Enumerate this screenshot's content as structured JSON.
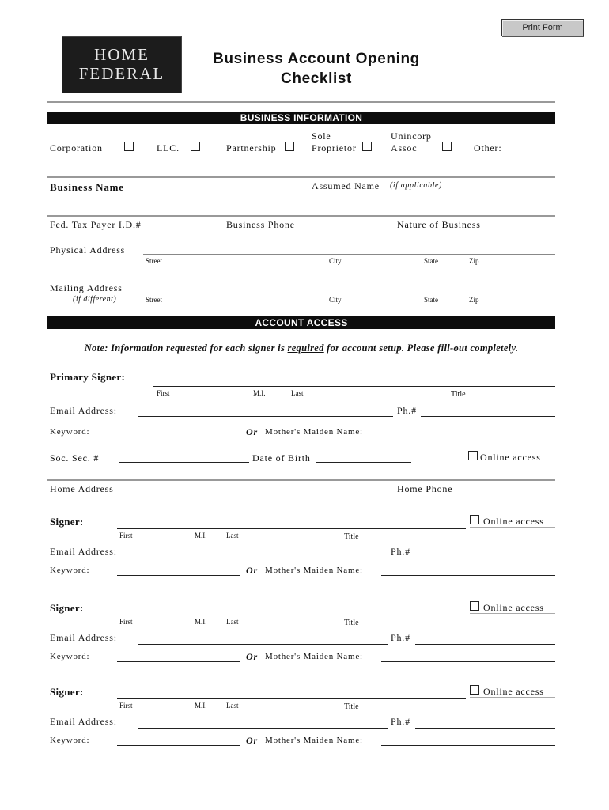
{
  "toolbar": {
    "print_label": "Print Form"
  },
  "logo": {
    "line1": "HOME",
    "line2": "FEDERAL"
  },
  "header": {
    "title_line1": "Business Account Opening",
    "title_line2": "Checklist"
  },
  "business_info": {
    "section_title": "BUSINESS INFORMATION",
    "entity_types": {
      "corporation": "Corporation",
      "llc": "LLC.",
      "partnership": "Partnership",
      "sole_proprietor_1": "Sole",
      "sole_proprietor_2": "Proprietor",
      "unincorp_1": "Unincorp",
      "unincorp_2": "Assoc",
      "other": "Other:"
    },
    "business_name": "Business Name",
    "assumed_name": "Assumed Name",
    "assumed_name_note": "(if applicable)",
    "tax_id": "Fed. Tax Payer I.D.#",
    "business_phone": "Business Phone",
    "nature_of_business": "Nature of Business",
    "physical_address": "Physical Address",
    "mailing_address": "Mailing Address",
    "mailing_note": "(if different)",
    "address_parts": {
      "street": "Street",
      "city": "City",
      "state": "State",
      "zip": "Zip"
    }
  },
  "account_access": {
    "section_title": "ACCOUNT ACCESS",
    "note_before": "Note: Information requested for each signer is ",
    "note_required": "required",
    "note_after": " for account setup. Please fill-out completely.",
    "primary_signer": "Primary Signer:",
    "signer": "Signer:",
    "name_parts": {
      "first": "First",
      "mi": "M.I.",
      "last": "Last",
      "title": "Title"
    },
    "email": "Email Address:",
    "phone": "Ph.#",
    "keyword": "Keyword:",
    "or": "Or",
    "maiden_name": "Mother's Maiden Name:",
    "ssn": "Soc. Sec. #",
    "dob": "Date of Birth",
    "online_access": "Online access",
    "home_address": "Home Address",
    "home_phone": "Home Phone"
  }
}
